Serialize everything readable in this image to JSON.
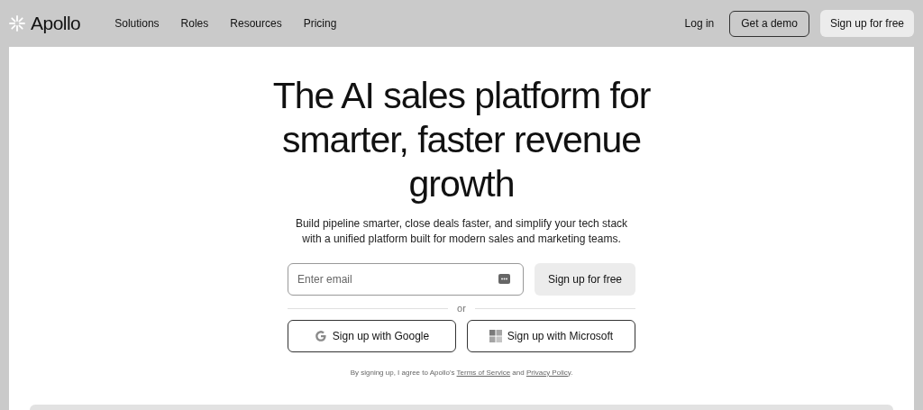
{
  "nav": {
    "brand": "Apollo",
    "links": [
      "Solutions",
      "Roles",
      "Resources",
      "Pricing"
    ],
    "login": "Log in",
    "demo": "Get a demo",
    "signup": "Sign up for free"
  },
  "hero": {
    "title": "The AI sales platform for smarter, faster revenue growth",
    "subtitle": "Build pipeline smarter, close deals faster, and simplify your tech stack with a unified platform built for modern sales and marketing teams.",
    "email": {
      "placeholder": "Enter email"
    },
    "signup": "Sign up for free",
    "divider": "or",
    "sso": [
      {
        "kind": "google",
        "label": "Sign up with Google"
      },
      {
        "kind": "microsoft",
        "label": "Sign up with Microsoft"
      }
    ],
    "legal": {
      "before": "By signing up, I agree to Apollo's ",
      "link_1": "Terms of Service",
      "middle": " and ",
      "link_2": "Privacy Policy",
      "after": "."
    }
  }
}
